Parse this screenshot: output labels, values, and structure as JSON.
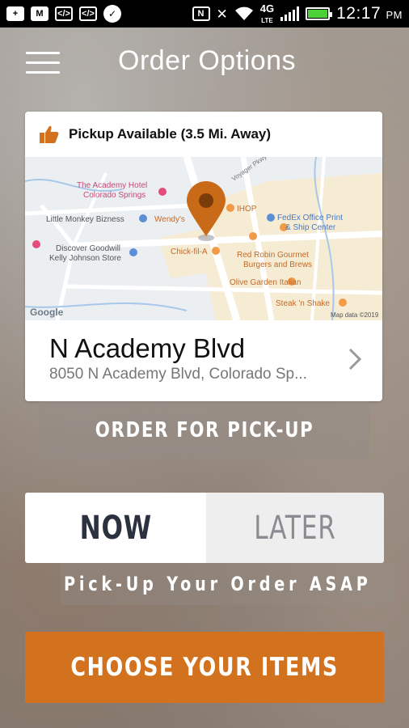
{
  "status_bar": {
    "time": "12:17",
    "ampm": "PM",
    "network": "4G",
    "network_sub": "LTE",
    "left_icons": [
      "plus-icon",
      "gmail-icon",
      "code-icon",
      "code-icon",
      "chat-icon"
    ],
    "right_icons": [
      "nfc-icon",
      "mute-icon",
      "wifi-icon",
      "signal-icon",
      "battery-icon"
    ]
  },
  "header": {
    "title": "Order Options",
    "menu_icon": "hamburger-menu-icon"
  },
  "location_card": {
    "pickup_status": "Pickup Available (3.5 Mi. Away)",
    "status_icon": "thumbs-up-icon",
    "map": {
      "labels": {
        "academy_hotel_1": "The Academy Hotel",
        "academy_hotel_2": "Colorado Springs",
        "little_monkey": "Little Monkey Bizness",
        "wendys": "Wendy's",
        "ihop": "IHOP",
        "fedex_1": "FedEx Office Print",
        "fedex_2": "& Ship Center",
        "goodwill_1": "Discover Goodwill",
        "goodwill_2": "Kelly Johnson Store",
        "chickfila": "Chick-fil-A",
        "red_robin_1": "Red Robin Gourmet",
        "red_robin_2": "Burgers and Brews",
        "olive_garden": "Olive Garden Italian",
        "steak_shake": "Steak 'n Shake",
        "road": "Voyager Pkwy",
        "google": "Google",
        "map_data": "Map data ©2019"
      }
    },
    "name": "N Academy Blvd",
    "address": "8050 N Academy Blvd, Colorado Sp..."
  },
  "order_mode": {
    "label": "ORDER FOR PICK-UP"
  },
  "timing": {
    "now": "NOW",
    "later": "LATER",
    "selected": "NOW",
    "caption": "Pick-Up Your Order ASAP"
  },
  "cta": {
    "label": "CHOOSE YOUR ITEMS"
  },
  "colors": {
    "accent": "#d2721f",
    "pin": "#c96a18",
    "dark_text": "#2c3140"
  }
}
